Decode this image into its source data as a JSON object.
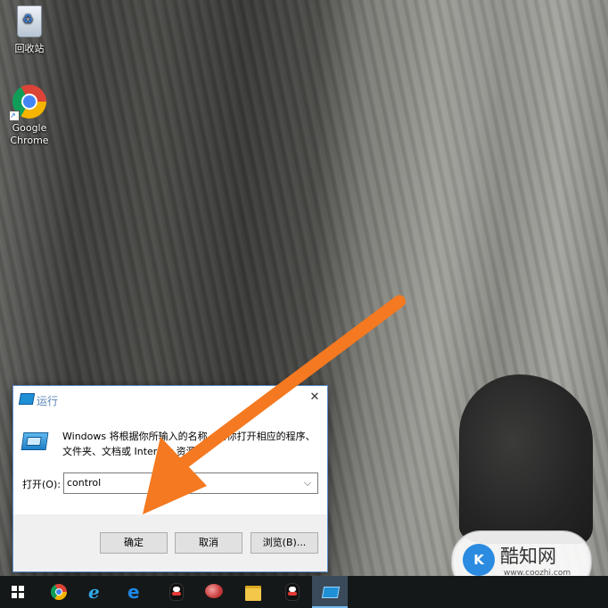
{
  "desktop": {
    "icons": [
      {
        "label": "回收站"
      },
      {
        "label": "Google Chrome"
      }
    ]
  },
  "run_dialog": {
    "title": "运行",
    "close_glyph": "✕",
    "description": "Windows 将根据你所输入的名称，为你打开相应的程序、文件夹、文档或 Internet 资源。",
    "open_label": "打开(O):",
    "open_value": "control",
    "ok_label": "确定",
    "cancel_label": "取消",
    "browse_label": "浏览(B)..."
  },
  "watermark": {
    "logo_text": "K",
    "title": "酷知网",
    "url": "www.coozhi.com"
  },
  "taskbar": {
    "items": [
      "windows-start",
      "chrome",
      "internet-explorer",
      "edge",
      "qq",
      "network-app",
      "file-explorer",
      "qq",
      "run"
    ],
    "active_item": "run"
  },
  "colors": {
    "arrow": "#f47920",
    "taskbar": "#151819",
    "dialog_border": "#5b8bc9",
    "title_text": "#5b85b8"
  }
}
